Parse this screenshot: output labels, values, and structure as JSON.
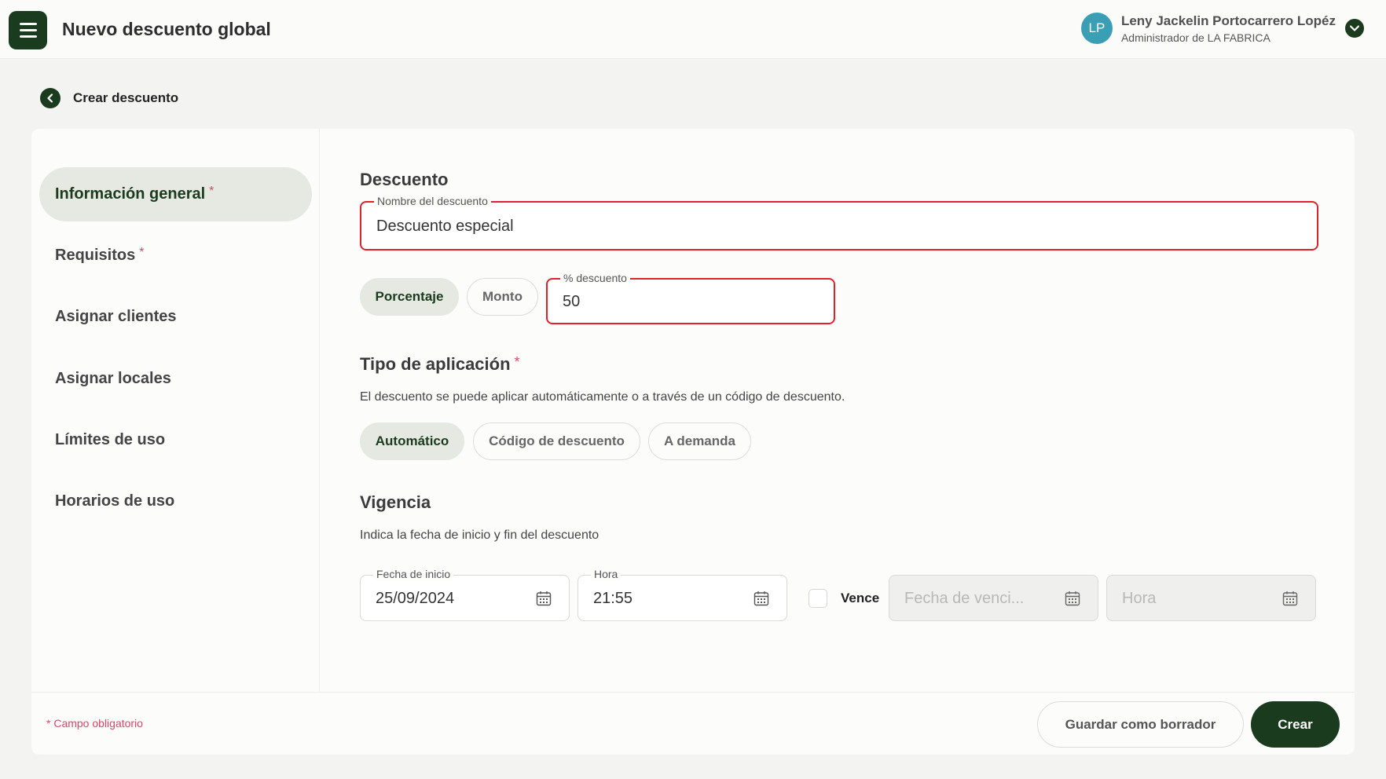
{
  "header": {
    "title": "Nuevo descuento global",
    "user": {
      "initials": "LP",
      "name": "Leny Jackelin Portocarrero Lopéz",
      "role": "Administrador de LA FABRICA"
    }
  },
  "breadcrumb": {
    "back_label": "Crear descuento"
  },
  "sidebar": {
    "items": [
      {
        "label": "Información general",
        "required": "*"
      },
      {
        "label": "Requisitos",
        "required": "*"
      },
      {
        "label": "Asignar clientes"
      },
      {
        "label": "Asignar locales"
      },
      {
        "label": "Límites de uso"
      },
      {
        "label": "Horarios de uso"
      }
    ]
  },
  "descuento": {
    "title": "Descuento",
    "name_label": "Nombre del descuento",
    "name_value": "Descuento especial",
    "type_options": [
      "Porcentaje",
      "Monto"
    ],
    "selected_type": "Porcentaje",
    "percent_label": "% descuento",
    "percent_value": "50"
  },
  "aplicacion": {
    "title": "Tipo de aplicación",
    "required": "*",
    "description": "El descuento se puede aplicar automáticamente o a través de un código de descuento.",
    "options": [
      "Automático",
      "Código de descuento",
      "A demanda"
    ],
    "selected": "Automático"
  },
  "vigencia": {
    "title": "Vigencia",
    "description": "Indica la fecha de inicio y fin del descuento",
    "start_date_label": "Fecha de inicio",
    "start_date_value": "25/09/2024",
    "start_time_label": "Hora",
    "start_time_value": "21:55",
    "expires_label": "Vence",
    "expires_checked": false,
    "end_date_placeholder": "Fecha de venci...",
    "end_time_placeholder": "Hora"
  },
  "footer": {
    "required_note": "* Campo obligatorio",
    "draft_label": "Guardar como borrador",
    "create_label": "Crear"
  },
  "colors": {
    "primary": "#1a3b1e",
    "error": "#e0212b",
    "required": "#e0456b",
    "avatar": "#3a9fb5",
    "selected_chip": "#e5e9e2"
  }
}
